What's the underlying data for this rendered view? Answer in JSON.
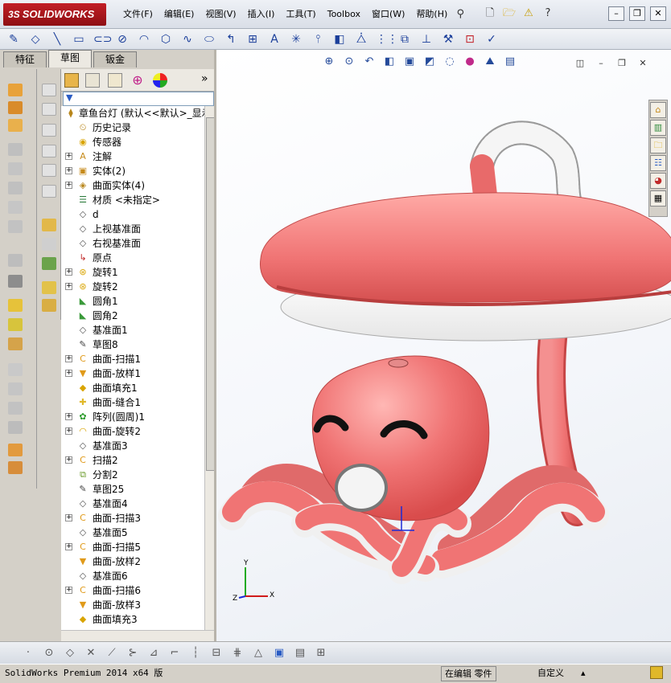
{
  "app": {
    "logo_prefix": "3S",
    "logo_text": "SOLIDWORKS"
  },
  "menu": [
    "文件(F)",
    "编辑(E)",
    "视图(V)",
    "插入(I)",
    "工具(T)",
    "Toolbox",
    "窗口(W)",
    "帮助(H)"
  ],
  "tabs": [
    {
      "label": "特征",
      "active": false
    },
    {
      "label": "草图",
      "active": true
    },
    {
      "label": "钣金",
      "active": false
    }
  ],
  "feature_tree": {
    "root": "章鱼台灯  (默认<<默认>_显示",
    "items": [
      {
        "label": "历史记录",
        "expand": false,
        "icon": "history-icon",
        "glyph": "⏲"
      },
      {
        "label": "传感器",
        "expand": false,
        "icon": "sensor-icon",
        "glyph": "◉"
      },
      {
        "label": "注解",
        "expand": true,
        "icon": "annotation-icon",
        "glyph": "A"
      },
      {
        "label": "实体(2)",
        "expand": true,
        "icon": "solid-bodies-icon",
        "glyph": "▣"
      },
      {
        "label": "曲面实体(4)",
        "expand": true,
        "icon": "surface-bodies-icon",
        "glyph": "◈"
      },
      {
        "label": "材质 <未指定>",
        "expand": false,
        "icon": "material-icon",
        "glyph": "☰"
      },
      {
        "label": "d",
        "expand": false,
        "icon": "plane-icon",
        "glyph": "◇"
      },
      {
        "label": "上视基准面",
        "expand": false,
        "icon": "plane-icon",
        "glyph": "◇"
      },
      {
        "label": "右视基准面",
        "expand": false,
        "icon": "plane-icon",
        "glyph": "◇"
      },
      {
        "label": "原点",
        "expand": false,
        "icon": "origin-icon",
        "glyph": "↳"
      },
      {
        "label": "旋转1",
        "expand": true,
        "icon": "revolve-icon",
        "glyph": "⊛"
      },
      {
        "label": "旋转2",
        "expand": true,
        "icon": "revolve-icon",
        "glyph": "⊛"
      },
      {
        "label": "圆角1",
        "expand": false,
        "icon": "fillet-icon",
        "glyph": "◣"
      },
      {
        "label": "圆角2",
        "expand": false,
        "icon": "fillet-icon",
        "glyph": "◣"
      },
      {
        "label": "基准面1",
        "expand": false,
        "icon": "plane-icon",
        "glyph": "◇"
      },
      {
        "label": "草图8",
        "expand": false,
        "icon": "sketch-icon",
        "glyph": "✎"
      },
      {
        "label": "曲面-扫描1",
        "expand": true,
        "icon": "sweep-icon",
        "glyph": "C"
      },
      {
        "label": "曲面-放样1",
        "expand": true,
        "icon": "loft-icon",
        "glyph": "▼"
      },
      {
        "label": "曲面填充1",
        "expand": false,
        "icon": "fill-icon",
        "glyph": "◆"
      },
      {
        "label": "曲面-缝合1",
        "expand": false,
        "icon": "knit-icon",
        "glyph": "✚"
      },
      {
        "label": "阵列(圆周)1",
        "expand": true,
        "icon": "pattern-icon",
        "glyph": "✿"
      },
      {
        "label": "曲面-旋转2",
        "expand": true,
        "icon": "surface-revolve-icon",
        "glyph": "◠"
      },
      {
        "label": "基准面3",
        "expand": false,
        "icon": "plane-icon",
        "glyph": "◇"
      },
      {
        "label": "扫描2",
        "expand": true,
        "icon": "sweep-icon",
        "glyph": "C"
      },
      {
        "label": "分割2",
        "expand": false,
        "icon": "split-icon",
        "glyph": "⧉"
      },
      {
        "label": "草图25",
        "expand": false,
        "icon": "sketch-icon",
        "glyph": "✎"
      },
      {
        "label": "基准面4",
        "expand": false,
        "icon": "plane-icon",
        "glyph": "◇"
      },
      {
        "label": "曲面-扫描3",
        "expand": true,
        "icon": "sweep-icon",
        "glyph": "C"
      },
      {
        "label": "基准面5",
        "expand": false,
        "icon": "plane-icon",
        "glyph": "◇"
      },
      {
        "label": "曲面-扫描5",
        "expand": true,
        "icon": "sweep-icon",
        "glyph": "C"
      },
      {
        "label": "曲面-放样2",
        "expand": false,
        "icon": "loft-icon",
        "glyph": "▼"
      },
      {
        "label": "基准面6",
        "expand": false,
        "icon": "plane-icon",
        "glyph": "◇"
      },
      {
        "label": "曲面-扫描6",
        "expand": true,
        "icon": "sweep-icon",
        "glyph": "C"
      },
      {
        "label": "曲面-放样3",
        "expand": false,
        "icon": "loft-icon",
        "glyph": "▼"
      },
      {
        "label": "曲面填充3",
        "expand": false,
        "icon": "fill-icon",
        "glyph": "◆"
      }
    ]
  },
  "triad": {
    "x": "X",
    "y": "Y",
    "z": "Z"
  },
  "status": {
    "product": "SolidWorks Premium 2014 x64 版",
    "mode": "在编辑 零件",
    "custom": "自定义"
  },
  "colors": {
    "model_body": "#f07474",
    "model_light": "#ffffff",
    "accent": "#c21f26"
  }
}
